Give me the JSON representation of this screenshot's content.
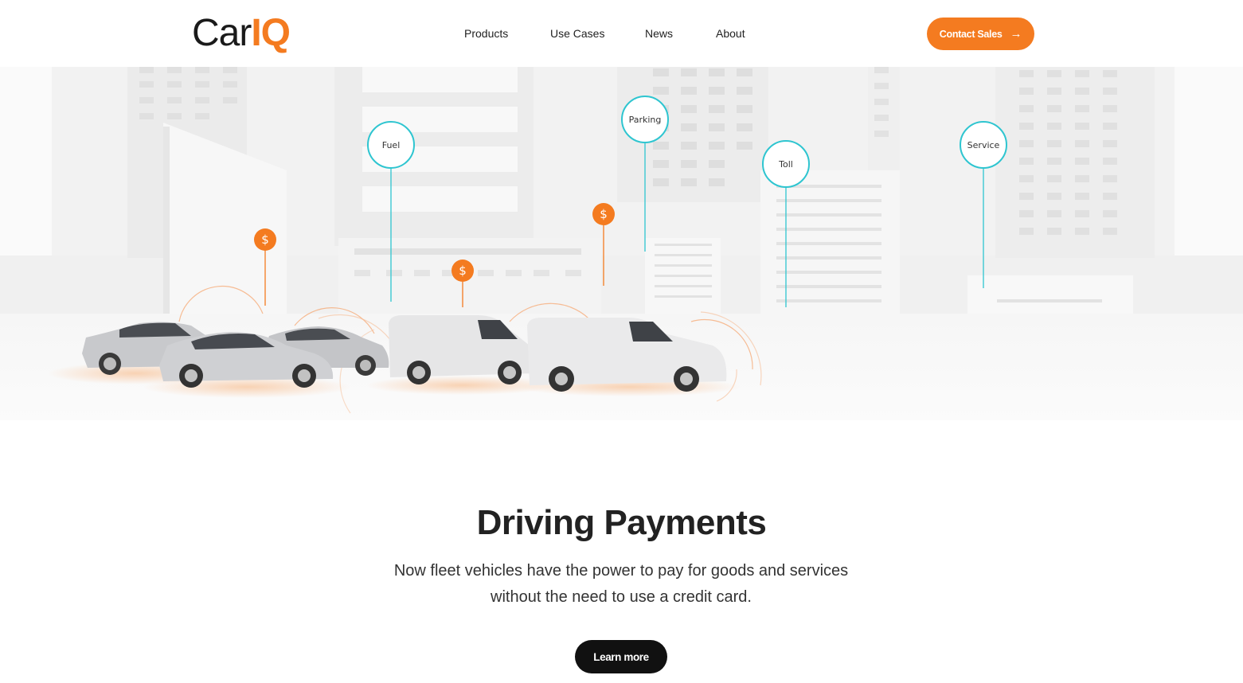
{
  "brand": {
    "logo_main": "Car",
    "logo_accent": "IQ",
    "accent_color": "#f47b20",
    "teal_color": "#2ec5d0"
  },
  "nav": {
    "items": [
      {
        "label": "Products"
      },
      {
        "label": "Use Cases"
      },
      {
        "label": "News"
      },
      {
        "label": "About"
      }
    ]
  },
  "header": {
    "cta_label": "Contact Sales",
    "cta_icon": "arrow-right-icon"
  },
  "hero": {
    "bubbles": [
      {
        "label": "Fuel"
      },
      {
        "label": "Parking"
      },
      {
        "label": "Toll"
      },
      {
        "label": "Service"
      }
    ],
    "payment_symbol": "$"
  },
  "section": {
    "title": "Driving Payments",
    "subtitle": "Now fleet vehicles have the power to pay for goods and services without the need to use a credit card.",
    "button_label": "Learn more"
  }
}
